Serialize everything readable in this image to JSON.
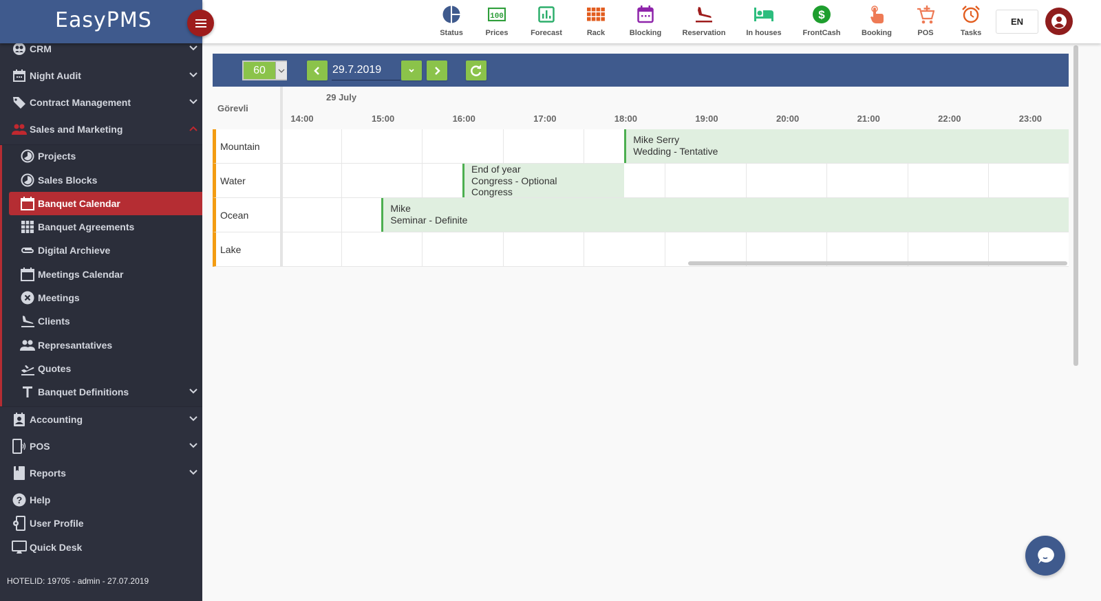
{
  "app": {
    "brand": "EasyPMS"
  },
  "sidebar": {
    "items": [
      {
        "label": "CRM",
        "icon": "crm-icon",
        "expandable": true,
        "expanded": false
      },
      {
        "label": "Night Audit",
        "icon": "calendar-icon",
        "expandable": true,
        "expanded": false
      },
      {
        "label": "Contract Management",
        "icon": "tag-icon",
        "expandable": true,
        "expanded": false
      },
      {
        "label": "Sales and Marketing",
        "icon": "people-icon",
        "expandable": true,
        "expanded": true
      }
    ],
    "sub_items": [
      {
        "label": "Projects",
        "icon": "pie-icon"
      },
      {
        "label": "Sales Blocks",
        "icon": "pie-icon"
      },
      {
        "label": "Banquet Calendar",
        "icon": "calendar-icon",
        "active": true
      },
      {
        "label": "Banquet Agreements",
        "icon": "grid-icon"
      },
      {
        "label": "Digital Archieve",
        "icon": "paperclip-icon"
      },
      {
        "label": "Meetings Calendar",
        "icon": "calendar-icon"
      },
      {
        "label": "Meetings",
        "icon": "close-circle-icon"
      },
      {
        "label": "Clients",
        "icon": "flight-land-icon"
      },
      {
        "label": "Represantatives",
        "icon": "people-icon"
      },
      {
        "label": "Quotes",
        "icon": "flight-takeoff-icon"
      },
      {
        "label": "Banquet Definitions",
        "icon": "text-icon",
        "expandable": true
      }
    ],
    "bottom_items": [
      {
        "label": "Accounting",
        "icon": "contact-icon",
        "expandable": true
      },
      {
        "label": "POS",
        "icon": "device-icon",
        "expandable": true
      },
      {
        "label": "Reports",
        "icon": "book-icon",
        "expandable": true
      },
      {
        "label": "Help",
        "icon": "help-icon"
      },
      {
        "label": "User Profile",
        "icon": "settings-phone-icon"
      },
      {
        "label": "Quick Desk",
        "icon": "monitor-icon"
      }
    ],
    "footer": "HOTELID: 19705 - admin - 27.07.2019"
  },
  "topbar": {
    "items": [
      {
        "label": "Status",
        "icon": "status-pie-icon",
        "color": "#3f5a8d"
      },
      {
        "label": "Prices",
        "icon": "money-icon",
        "color": "#2e9e3a"
      },
      {
        "label": "Forecast",
        "icon": "chart-icon",
        "color": "#2dae6b"
      },
      {
        "label": "Rack",
        "icon": "rack-grid-icon",
        "color": "#e25d1f"
      },
      {
        "label": "Blocking",
        "icon": "calendar-icon",
        "color": "#8e24aa"
      },
      {
        "label": "Reservation",
        "icon": "flight-land-icon",
        "color": "#9e1c1c"
      },
      {
        "label": "In houses",
        "icon": "bed-icon",
        "color": "#2dbd7e"
      },
      {
        "label": "FrontCash",
        "icon": "dollar-icon",
        "color": "#1e9e2e"
      },
      {
        "label": "Booking",
        "icon": "touch-icon",
        "color": "#ee7a55"
      },
      {
        "label": "POS",
        "icon": "cart-icon",
        "color": "#ee7a55"
      },
      {
        "label": "Tasks",
        "icon": "alarm-icon",
        "color": "#e25d1f"
      }
    ],
    "language": "EN"
  },
  "toolbar": {
    "interval_value": "60",
    "date_value": "29.7.2019"
  },
  "calendar": {
    "resource_header": "Görevli",
    "date_label": "29 July",
    "hours": [
      "14:00",
      "15:00",
      "16:00",
      "17:00",
      "18:00",
      "19:00",
      "20:00",
      "21:00",
      "22:00",
      "23:00"
    ],
    "rooms": [
      "Mountain",
      "Water",
      "Ocean",
      "Lake"
    ],
    "events": [
      {
        "room": "Mountain",
        "lines": [
          "Mike Serry",
          "Wedding - Tentative"
        ],
        "start": "18:30",
        "end": "24:00"
      },
      {
        "room": "Water",
        "lines": [
          "End of year",
          "Congress - Optional",
          "Congress"
        ],
        "start": "16:30",
        "end": "18:30"
      },
      {
        "room": "Ocean",
        "lines": [
          "Mike",
          "Seminar - Definite"
        ],
        "start": "15:30",
        "end": "24:00"
      }
    ]
  },
  "colors": {
    "brand": "#3f5a8d",
    "accent_red": "#b52d33",
    "action_green": "#8bc34a",
    "event_bg": "#e0efe0",
    "event_border": "#4caf50",
    "room_marker": "#f39c12"
  }
}
